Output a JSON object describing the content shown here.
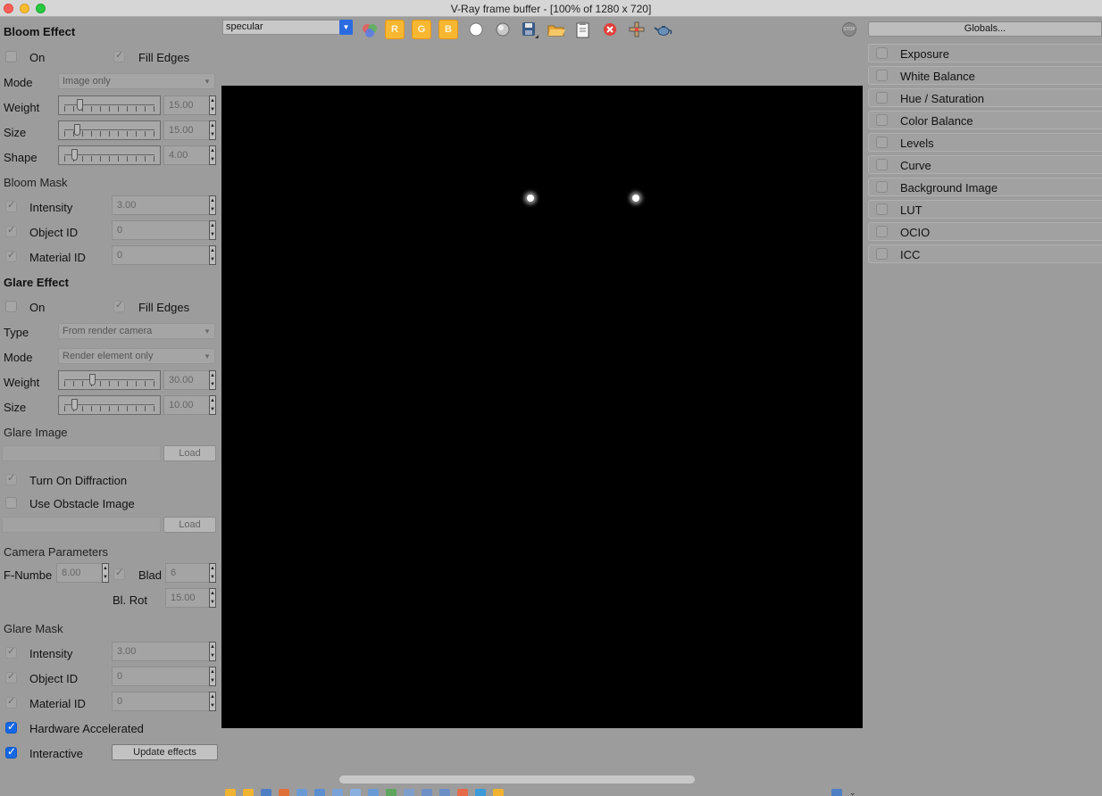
{
  "window": {
    "title": "V-Ray frame buffer - [100% of 1280 x 720]"
  },
  "toolbar": {
    "channel": "specular",
    "channel_r": "R",
    "channel_g": "G",
    "channel_b": "B",
    "stop_label": "STOP"
  },
  "bloom": {
    "header": "Bloom Effect",
    "on_label": "On",
    "fill_edges_label": "Fill Edges",
    "mode_label": "Mode",
    "mode_value": "Image only",
    "weight_label": "Weight",
    "weight_value": "15.00",
    "weight_level": 0.15,
    "size_label": "Size",
    "size_value": "15.00",
    "size_level": 0.12,
    "shape_label": "Shape",
    "shape_value": "4.00",
    "shape_level": 0.08,
    "mask_header": "Bloom Mask",
    "intensity_label": "Intensity",
    "intensity_value": "3.00",
    "object_id_label": "Object ID",
    "object_id_value": "0",
    "material_id_label": "Material ID",
    "material_id_value": "0"
  },
  "glare": {
    "header": "Glare Effect",
    "on_label": "On",
    "fill_edges_label": "Fill Edges",
    "type_label": "Type",
    "type_value": "From render camera",
    "mode_label": "Mode",
    "mode_value": "Render element only",
    "weight_label": "Weight",
    "weight_value": "30.00",
    "weight_level": 0.3,
    "size_label": "Size",
    "size_value": "10.00",
    "size_level": 0.08,
    "image_header": "Glare Image",
    "load_label": "Load",
    "diffraction_label": "Turn On Diffraction",
    "obstacle_label": "Use Obstacle Image",
    "load2_label": "Load",
    "camera_header": "Camera Parameters",
    "fnumber_label": "F-Numbe",
    "fnumber_value": "8.00",
    "blades_label": "Blad",
    "blades_value": "6",
    "blrot_label": "Bl. Rot",
    "blrot_value": "15.00",
    "mask_header": "Glare Mask",
    "intensity_label": "Intensity",
    "intensity_value": "3.00",
    "object_id_label": "Object ID",
    "object_id_value": "0",
    "material_id_label": "Material ID",
    "material_id_value": "0",
    "hw_label": "Hardware Accelerated",
    "interactive_label": "Interactive",
    "update_label": "Update effects"
  },
  "right_panel": {
    "globals_label": "Globals...",
    "items": [
      {
        "label": "Exposure"
      },
      {
        "label": "White Balance"
      },
      {
        "label": "Hue / Saturation"
      },
      {
        "label": "Color Balance"
      },
      {
        "label": "Levels"
      },
      {
        "label": "Curve"
      },
      {
        "label": "Background Image"
      },
      {
        "label": "LUT"
      },
      {
        "label": "OCIO"
      },
      {
        "label": "ICC"
      }
    ]
  }
}
